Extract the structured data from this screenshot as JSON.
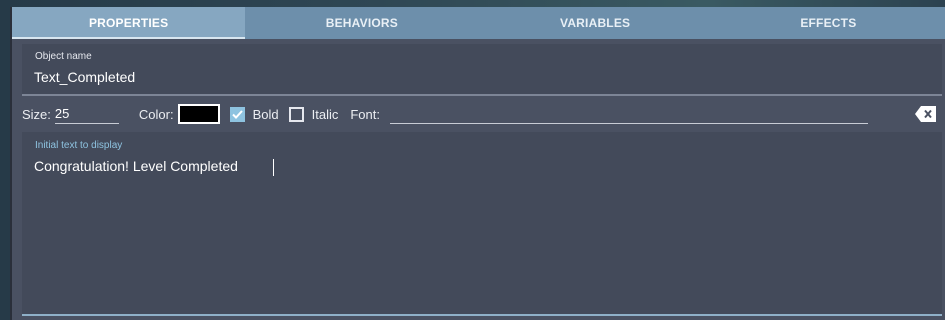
{
  "tabs": [
    {
      "label": "PROPERTIES",
      "active": true
    },
    {
      "label": "BEHAVIORS",
      "active": false
    },
    {
      "label": "VARIABLES",
      "active": false
    },
    {
      "label": "EFFECTS",
      "active": false
    }
  ],
  "object_name": {
    "label": "Object name",
    "value": "Text_Completed"
  },
  "toolbar": {
    "size_label": "Size:",
    "size_value": "25",
    "color_label": "Color:",
    "color_value": "#000000",
    "bold_label": "Bold",
    "bold_checked": true,
    "italic_label": "Italic",
    "italic_checked": false,
    "font_label": "Font:",
    "font_value": "",
    "clear_icon": "backspace-clear-icon"
  },
  "text": {
    "label": "Initial text to display",
    "value": "Congratulation! Level Completed"
  },
  "colors": {
    "tab_bar": "#6d8fab",
    "tab_active": "#86a7c1",
    "panel": "#4a5162",
    "field": "#434a5a",
    "accent": "#8ec3e0"
  }
}
